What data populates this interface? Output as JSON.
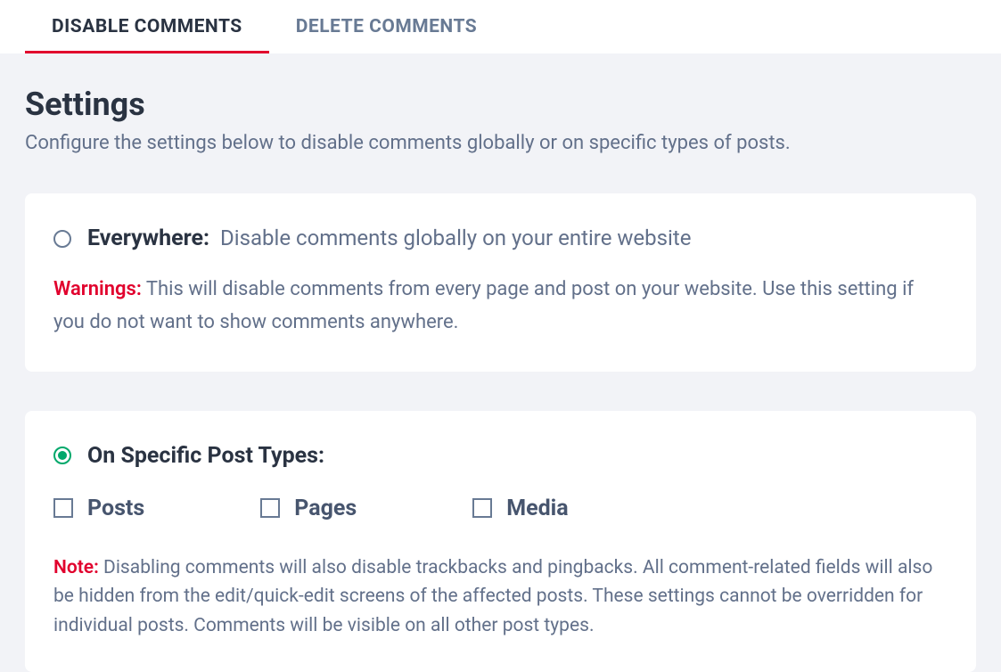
{
  "tabs": {
    "disable": "DISABLE COMMENTS",
    "delete": "DELETE COMMENTS"
  },
  "header": {
    "title": "Settings",
    "subtitle": "Configure the settings below to disable comments globally or on specific types of posts."
  },
  "everywhere": {
    "label": "Everywhere:",
    "desc": "Disable comments globally on your entire website",
    "warning_label": "Warnings:",
    "warning_text": "This will disable comments from every page and post on your website. Use this setting if you do not want to show comments anywhere."
  },
  "specific": {
    "label": "On Specific Post Types:",
    "checkboxes": {
      "posts": "Posts",
      "pages": "Pages",
      "media": "Media"
    },
    "note_label": "Note:",
    "note_text": "Disabling comments will also disable trackbacks and pingbacks. All comment-related fields will also be hidden from the edit/quick-edit screens of the affected posts. These settings cannot be overridden for individual posts. Comments will be visible on all other post types."
  }
}
